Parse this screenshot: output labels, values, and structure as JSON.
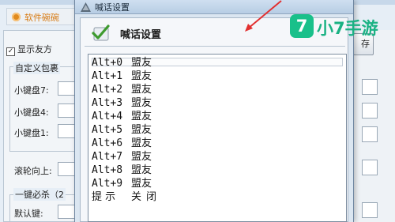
{
  "background_app": {
    "header_label": "软件碗碗",
    "checkbox_label": "显示友方",
    "group_title": "自定义包裹",
    "fields": [
      {
        "label": "小键盘7:"
      },
      {
        "label": "小键盘4:"
      },
      {
        "label": "小键盘1:"
      }
    ],
    "scroll_label": "滚轮向上:",
    "combo_group_title": "一键必杀（2",
    "default_key_label": "默认键:",
    "save_button_label": "存"
  },
  "watermark": {
    "badge_char": "7",
    "text": "小7手游"
  },
  "dialog": {
    "window_title": "喊话设置",
    "heading": "喊话设置",
    "items": [
      {
        "key": "Alt+0",
        "text": "盟友"
      },
      {
        "key": "Alt+1",
        "text": "盟友"
      },
      {
        "key": "Alt+2",
        "text": "盟友"
      },
      {
        "key": "Alt+3",
        "text": "盟友"
      },
      {
        "key": "Alt+4",
        "text": "盟友"
      },
      {
        "key": "Alt+5",
        "text": "盟友"
      },
      {
        "key": "Alt+6",
        "text": "盟友"
      },
      {
        "key": "Alt+7",
        "text": "盟友"
      },
      {
        "key": "Alt+8",
        "text": "盟友"
      },
      {
        "key": "Alt+9",
        "text": "盟友"
      }
    ],
    "footer_item": {
      "key": "提 示",
      "text": "关闭"
    }
  },
  "colors": {
    "annotation_arrow": "#e23030",
    "watermark_green": "#19c08a",
    "header_orange": "#d77a12"
  }
}
